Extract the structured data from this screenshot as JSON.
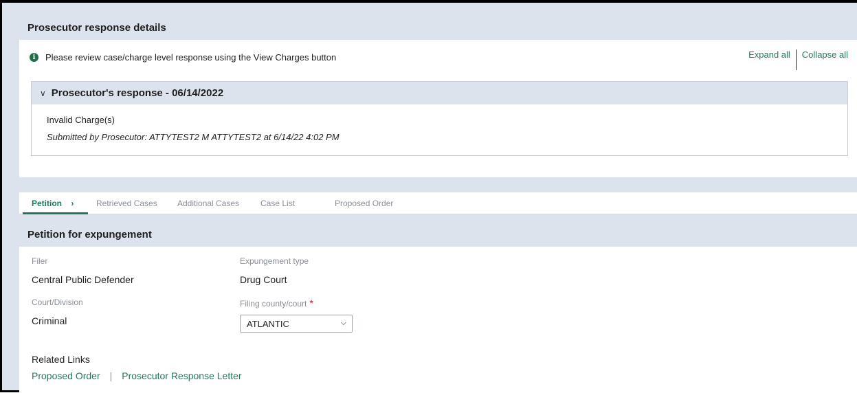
{
  "response_panel": {
    "title": "Prosecutor response details",
    "info_text": "Please review case/charge level response using the View Charges button",
    "expand_all": "Expand all",
    "collapse_all": "Collapse all",
    "response": {
      "header": "Prosecutor's response - 06/14/2022",
      "status": "Invalid Charge(s)",
      "submitted_by": "Submitted by  Prosecutor:  ATTYTEST2 M ATTYTEST2  at  6/14/22 4:02 PM"
    }
  },
  "tabs": [
    {
      "label": "Petition",
      "active": true,
      "chevron": "›"
    },
    {
      "label": "Retrieved Cases"
    },
    {
      "label": "Additional Cases"
    },
    {
      "label": "Case List"
    },
    {
      "label": "Proposed Order"
    }
  ],
  "petition": {
    "title": "Petition for expungement",
    "filer_label": "Filer",
    "filer_value": "Central Public Defender",
    "exp_type_label": "Expungement type",
    "exp_type_value": "Drug Court",
    "court_label": "Court/Division",
    "court_value": "Criminal",
    "county_label": "Filing county/court",
    "county_required": "*",
    "county_value": "ATLANTIC",
    "related_title": "Related Links",
    "related_links": [
      "Proposed Order",
      "Prosecutor Response Letter"
    ],
    "separator": "|"
  },
  "colors": {
    "accent": "#1f7a5a",
    "header_bg": "#dde3ec",
    "required": "#c8102e"
  }
}
